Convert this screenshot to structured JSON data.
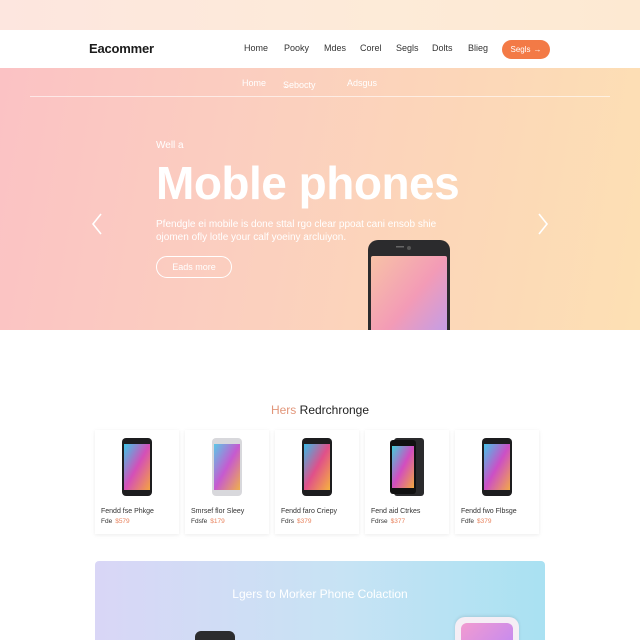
{
  "brand": "Eacommer",
  "nav": {
    "links": [
      "Home",
      "Pooky",
      "Mdes",
      "Corel",
      "Segls",
      "Dolts",
      "Blieg"
    ],
    "cta_label": "Segls",
    "cta_icon": "arrow-right-icon"
  },
  "subnav": {
    "items": [
      "Home",
      "Sebocty",
      "Adsgus"
    ],
    "dropdown_icon": "chevron-down-icon"
  },
  "hero": {
    "eyebrow": "Well a",
    "title": "Moble phones",
    "description": "Pfendgle ei mobile is done sttal rgo clear ppoat cani ensob shie ojomen ofly lotle your calf yoeiny arcluiyon.",
    "button_label": "Eads more",
    "prev_icon": "chevron-left-icon",
    "next_icon": "chevron-right-icon",
    "background_start": "#fbc2c4",
    "background_end": "#fde0b4"
  },
  "featured": {
    "title_prefix": "Hers",
    "title_main": "Redrchronge",
    "products": [
      {
        "name": "Fendd fse Phkge",
        "price_label": "Fde",
        "price": "$579",
        "color": "dark"
      },
      {
        "name": "Smrsef flor Sleey",
        "price_label": "Fdsfe",
        "price": "$179",
        "color": "silver"
      },
      {
        "name": "Fendd faro Criepy",
        "price_label": "Fdrs",
        "price": "$379",
        "color": "dark"
      },
      {
        "name": "Fend aid Ctrkes",
        "price_label": "Fdrse",
        "price": "$377",
        "color": "black"
      },
      {
        "name": "Fendd fwo Flbsge",
        "price_label": "Fdfe",
        "price": "$379",
        "color": "dark"
      }
    ]
  },
  "promo": {
    "title": "Lgers to Morker Phone Colaction",
    "background_start": "#d9d6f6",
    "background_end": "#a9e1f2"
  },
  "colors": {
    "accent": "#f37a46",
    "price": "#e9835e"
  }
}
